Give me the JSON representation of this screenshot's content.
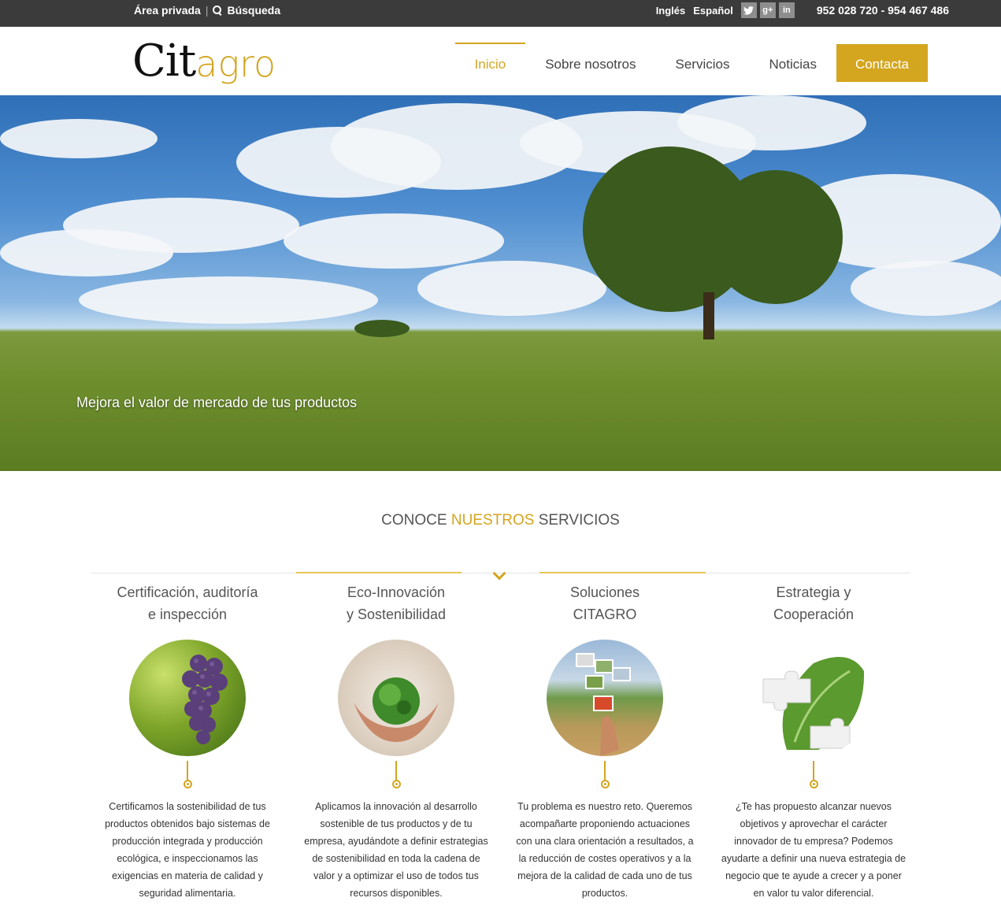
{
  "topbar": {
    "private_area": "Área privada",
    "search": "Búsqueda",
    "lang_en": "Inglés",
    "lang_es": "Español",
    "social": [
      "twitter-icon",
      "google-plus-icon",
      "linkedin-icon"
    ],
    "phone": "952 028 720 - 954 467 486"
  },
  "header": {
    "logo_part1": "Cit",
    "logo_part2": "agro",
    "nav": [
      "Inicio",
      "Sobre nosotros",
      "Servicios",
      "Noticias"
    ],
    "cta": "Contacta"
  },
  "hero": {
    "caption": "Mejora el valor de mercado de tus productos"
  },
  "services": {
    "title_pre": "CONOCE ",
    "title_accent": "NUESTROS",
    "title_post": " SERVICIOS",
    "items": [
      {
        "title1": "Certificación, auditoría",
        "title2": "e inspección",
        "text": "Certificamos la sostenibilidad de tus productos obtenidos bajo sistemas de producción integrada y producción ecológica, e inspeccionamos las exigencias en materia de calidad y seguridad alimentaria."
      },
      {
        "title1": "Eco-Innovación",
        "title2": "y Sostenibilidad",
        "text": "Aplicamos la innovación al desarrollo sostenible de tus productos y de tu empresa, ayudándote a definir estrategias de sostenibilidad en toda la cadena de valor y a optimizar el uso de todos tus recursos disponibles."
      },
      {
        "title1": "Soluciones",
        "title2": "CITAGRO",
        "text": "Tu problema es nuestro reto. Queremos acompañarte proponiendo actuaciones con una clara orientación a resultados, a la reducción de costes operativos y a la mejora de la calidad de cada uno de tus productos."
      },
      {
        "title1": "Estrategia y",
        "title2": "Cooperación",
        "text": "¿Te has propuesto alcanzar nuevos objetivos y aprovechar el carácter innovador de tu empresa? Podemos ayudarte a definir una nueva estrategia de negocio que te ayude a crecer y a poner en valor tu valor diferencial."
      }
    ]
  },
  "colors": {
    "accent": "#d4a51f",
    "topbar": "#3b3b3b"
  }
}
